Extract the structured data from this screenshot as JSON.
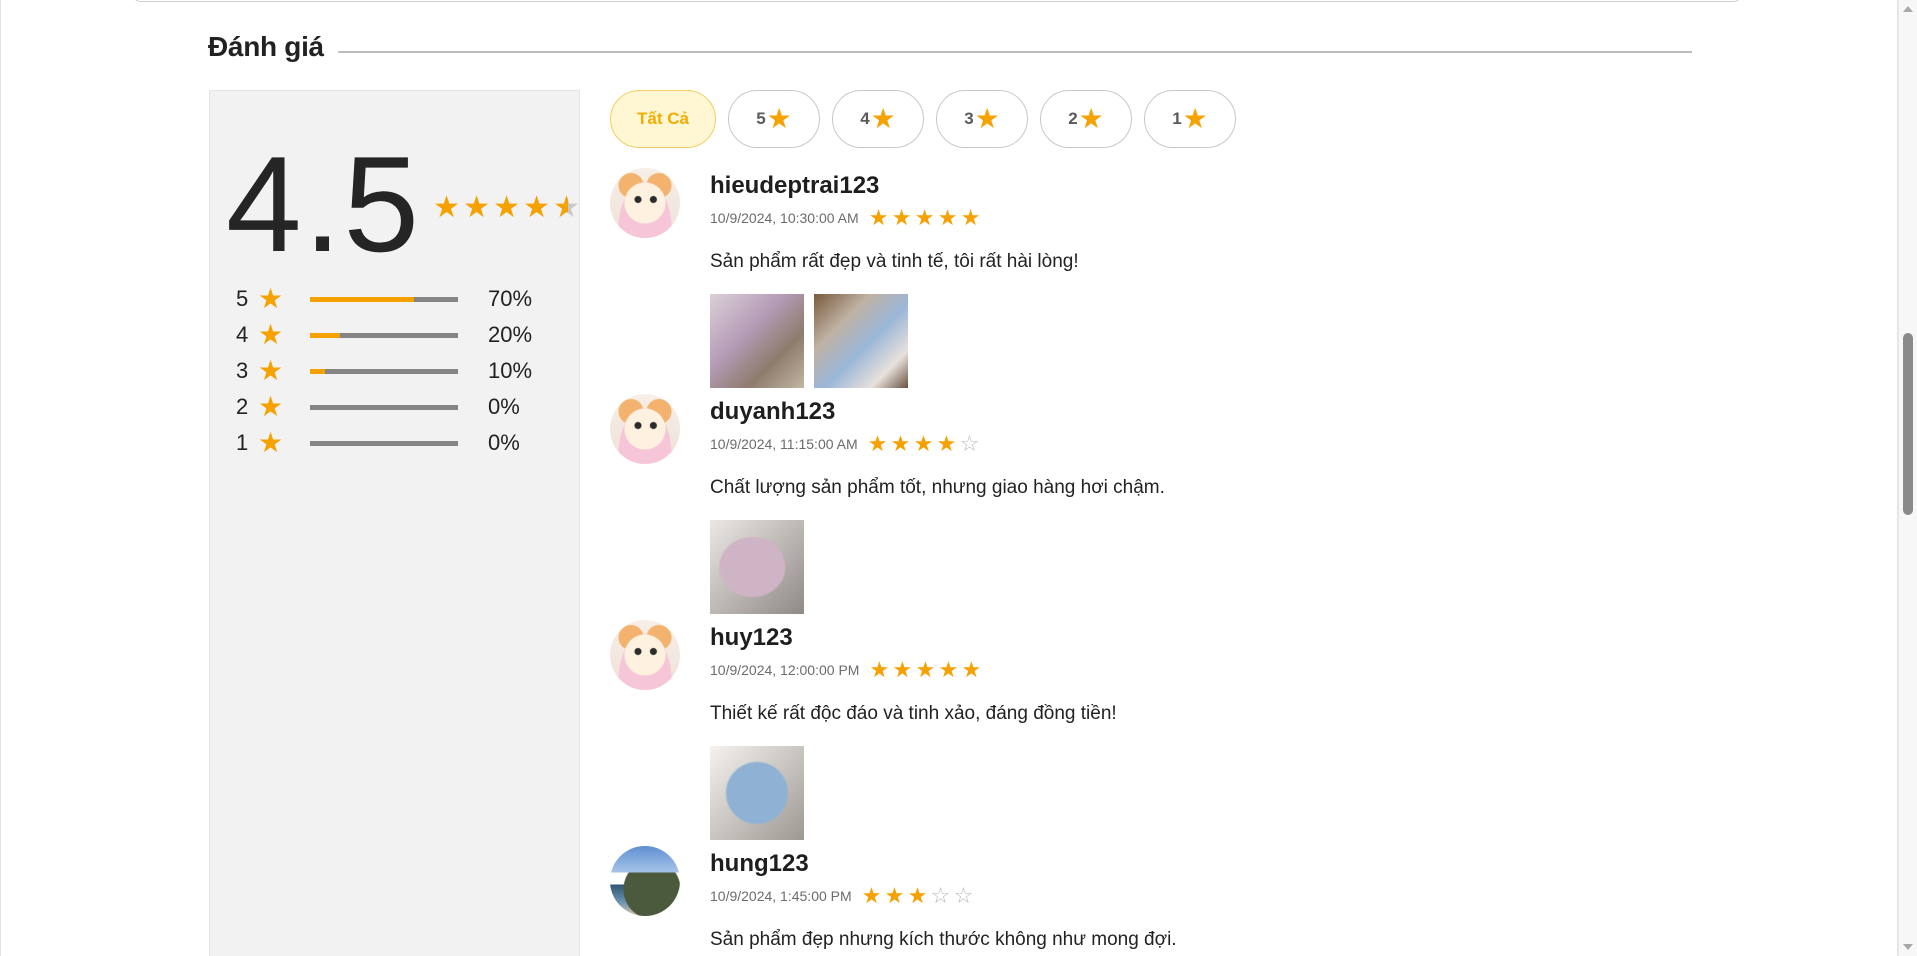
{
  "section": {
    "title": "Đánh giá"
  },
  "summary": {
    "average": "4.5",
    "average_stars": [
      "full",
      "full",
      "full",
      "full",
      "half"
    ],
    "distribution": [
      {
        "stars": "5",
        "percent_label": "70%",
        "percent": 70
      },
      {
        "stars": "4",
        "percent_label": "20%",
        "percent": 20
      },
      {
        "stars": "3",
        "percent_label": "10%",
        "percent": 10
      },
      {
        "stars": "2",
        "percent_label": "0%",
        "percent": 0
      },
      {
        "stars": "1",
        "percent_label": "0%",
        "percent": 0
      }
    ]
  },
  "filters": [
    {
      "label": "Tất Cả",
      "active": true
    },
    {
      "label": "5",
      "active": false
    },
    {
      "label": "4",
      "active": false
    },
    {
      "label": "3",
      "active": false
    },
    {
      "label": "2",
      "active": false
    },
    {
      "label": "1",
      "active": false
    }
  ],
  "reviews": [
    {
      "user": "hieudeptrai123",
      "time": "10/9/2024, 10:30:00 AM",
      "rating": 5,
      "text": "Sản phẩm rất đẹp và tinh tế, tôi rất hài lòng!"
    },
    {
      "user": "duyanh123",
      "time": "10/9/2024, 11:15:00 AM",
      "rating": 4,
      "text": "Chất lượng sản phẩm tốt, nhưng giao hàng hơi chậm."
    },
    {
      "user": "huy123",
      "time": "10/9/2024, 12:00:00 PM",
      "rating": 5,
      "text": "Thiết kế rất độc đáo và tinh xảo, đáng đồng tiền!"
    },
    {
      "user": "hung123",
      "time": "10/9/2024, 1:45:00 PM",
      "rating": 3,
      "text": "Sản phẩm đẹp nhưng kích thước không như mong đợi."
    }
  ],
  "colors": {
    "accent": "#f5a100",
    "chip_active_bg": "#fff6d4",
    "chip_active_text": "#f2ae00",
    "bar_track": "#858585"
  }
}
